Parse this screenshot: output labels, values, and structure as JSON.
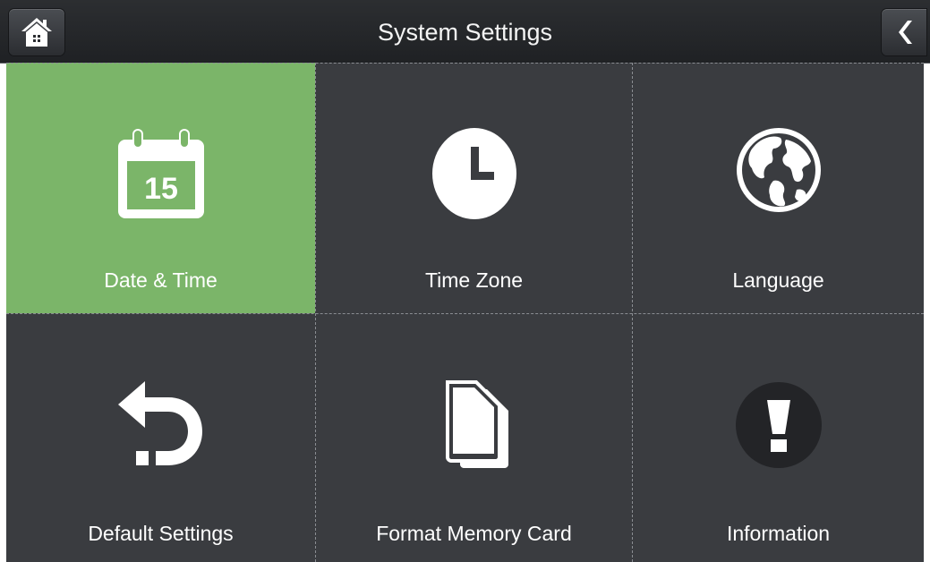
{
  "header": {
    "title": "System Settings",
    "home_icon": "home-icon",
    "back_icon": "chevron-left-icon"
  },
  "tiles": [
    {
      "label": "Date & Time",
      "icon": "calendar-icon",
      "day": "15",
      "selected": true
    },
    {
      "label": "Time Zone",
      "icon": "clock-icon",
      "selected": false
    },
    {
      "label": "Language",
      "icon": "globe-icon",
      "selected": false
    },
    {
      "label": "Default Settings",
      "icon": "undo-arrow-icon",
      "selected": false
    },
    {
      "label": "Format Memory  Card",
      "icon": "memory-card-icon",
      "selected": false
    },
    {
      "label": "Information",
      "icon": "exclamation-icon",
      "selected": false
    }
  ],
  "colors": {
    "header_bg": "#232528",
    "tile_bg": "#3a3c40",
    "selected_bg": "#7bb569",
    "text": "#ffffff"
  }
}
